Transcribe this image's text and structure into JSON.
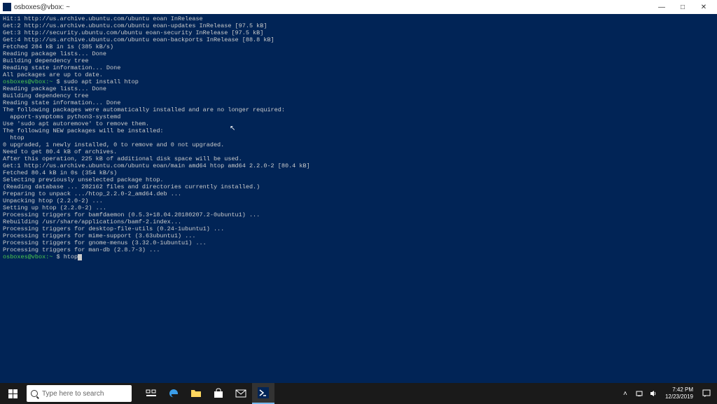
{
  "window": {
    "title": "osboxes@vbox: ~"
  },
  "terminal": {
    "lines": [
      "Hit:1 http://us.archive.ubuntu.com/ubuntu eoan InRelease",
      "Get:2 http://us.archive.ubuntu.com/ubuntu eoan-updates InRelease [97.5 kB]",
      "Get:3 http://security.ubuntu.com/ubuntu eoan-security InRelease [97.5 kB]",
      "Get:4 http://us.archive.ubuntu.com/ubuntu eoan-backports InRelease [88.8 kB]",
      "Fetched 284 kB in 1s (385 kB/s)",
      "Reading package lists... Done",
      "Building dependency tree",
      "Reading state information... Done",
      "All packages are up to date."
    ],
    "prompt1_user": "osboxes@vbox:~",
    "prompt1_dollar": "$",
    "prompt1_cmd": "sudo apt install htop",
    "lines2": [
      "Reading package lists... Done",
      "Building dependency tree",
      "Reading state information... Done",
      "The following packages were automatically installed and are no longer required:",
      "  apport-symptoms python3-systemd",
      "Use 'sudo apt autoremove' to remove them.",
      "The following NEW packages will be installed:",
      "  htop",
      "0 upgraded, 1 newly installed, 0 to remove and 0 not upgraded.",
      "Need to get 80.4 kB of archives.",
      "After this operation, 225 kB of additional disk space will be used.",
      "Get:1 http://us.archive.ubuntu.com/ubuntu eoan/main amd64 htop amd64 2.2.0-2 [80.4 kB]",
      "Fetched 80.4 kB in 0s (354 kB/s)",
      "Selecting previously unselected package htop.",
      "(Reading database ... 282162 files and directories currently installed.)",
      "Preparing to unpack .../htop_2.2.0-2_amd64.deb ...",
      "Unpacking htop (2.2.0-2) ...",
      "Setting up htop (2.2.0-2) ...",
      "Processing triggers for bamfdaemon (0.5.3+18.04.20180207.2-0ubuntu1) ...",
      "Rebuilding /usr/share/applications/bamf-2.index...",
      "Processing triggers for desktop-file-utils (0.24-1ubuntu1) ...",
      "Processing triggers for mime-support (3.63ubuntu1) ...",
      "Processing triggers for gnome-menus (3.32.0-1ubuntu1) ...",
      "Processing triggers for man-db (2.8.7-3) ..."
    ],
    "prompt2_user": "osboxes@vbox:~",
    "prompt2_dollar": "$",
    "prompt2_cmd": "htop"
  },
  "taskbar": {
    "search_placeholder": "Type here to search",
    "time": "7:42 PM",
    "date": "12/23/2019"
  }
}
